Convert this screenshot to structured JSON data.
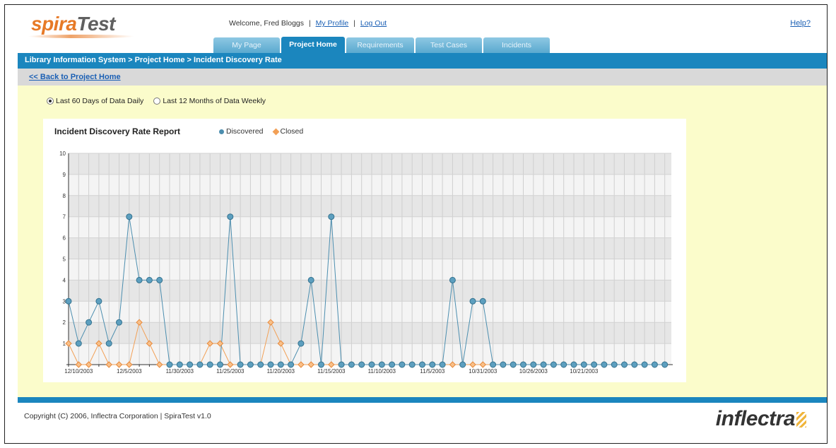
{
  "header": {
    "logo_part1": "spira",
    "logo_part2": "Test",
    "welcome_text": "Welcome, Fred Bloggs",
    "my_profile": "My Profile",
    "log_out": "Log Out",
    "help": "Help?"
  },
  "tabs": [
    {
      "label": "My Page",
      "active": false
    },
    {
      "label": "Project Home",
      "active": true
    },
    {
      "label": "Requirements",
      "active": false
    },
    {
      "label": "Test Cases",
      "active": false
    },
    {
      "label": "Incidents",
      "active": false
    }
  ],
  "breadcrumb": "Library Information System > Project Home > Incident Discovery Rate",
  "back_link": "<< Back to Project Home",
  "options": {
    "daily": "Last 60 Days of Data Daily",
    "weekly": "Last 12 Months of Data Weekly",
    "selected": "daily"
  },
  "chart_title": "Incident Discovery Rate Report",
  "legend": {
    "discovered": "Discovered",
    "closed": "Closed"
  },
  "colors": {
    "discovered": "#4c8eaf",
    "closed": "#f2a056",
    "accent": "#1b86be",
    "content_bg": "#fbfccb"
  },
  "chart_data": {
    "type": "line",
    "title": "Incident Discovery Rate Report",
    "xlabel": "",
    "ylabel": "",
    "ylim": [
      0,
      10
    ],
    "yticks": [
      1,
      2,
      3,
      4,
      5,
      6,
      7,
      8,
      9,
      10
    ],
    "grid": true,
    "legend_position": "top",
    "x_tick_labels": [
      {
        "index": 1,
        "label": "12/10/2003"
      },
      {
        "index": 6,
        "label": "12/5/2003"
      },
      {
        "index": 11,
        "label": "11/30/2003"
      },
      {
        "index": 16,
        "label": "11/25/2003"
      },
      {
        "index": 21,
        "label": "11/20/2003"
      },
      {
        "index": 26,
        "label": "11/15/2003"
      },
      {
        "index": 31,
        "label": "11/10/2003"
      },
      {
        "index": 36,
        "label": "11/5/2003"
      },
      {
        "index": 41,
        "label": "10/31/2003"
      },
      {
        "index": 46,
        "label": "10/26/2003"
      },
      {
        "index": 51,
        "label": "10/21/2003"
      }
    ],
    "series": [
      {
        "name": "Discovered",
        "values": [
          3,
          1,
          2,
          3,
          1,
          2,
          7,
          4,
          4,
          4,
          0,
          0,
          0,
          0,
          0,
          0,
          7,
          0,
          0,
          0,
          0,
          0,
          0,
          1,
          4,
          0,
          7,
          0,
          0,
          0,
          0,
          0,
          0,
          0,
          0,
          0,
          0,
          0,
          4,
          0,
          3,
          3,
          0,
          0,
          0,
          0,
          0,
          0,
          0,
          0,
          0,
          0,
          0,
          0,
          0,
          0,
          0,
          0,
          0,
          0
        ]
      },
      {
        "name": "Closed",
        "values": [
          1,
          0,
          0,
          1,
          0,
          0,
          0,
          2,
          1,
          0,
          0,
          0,
          0,
          0,
          1,
          1,
          0,
          0,
          0,
          0,
          2,
          1,
          0,
          0,
          0,
          0,
          0,
          0,
          0,
          0,
          0,
          0,
          0,
          0,
          0,
          0,
          0,
          0,
          0,
          0,
          0,
          0,
          0,
          0,
          0,
          0,
          0,
          0,
          0,
          0,
          0,
          0,
          0,
          0,
          0,
          0,
          0,
          0,
          0,
          0
        ]
      }
    ]
  },
  "footer": {
    "copyright": "Copyright (C) 2006, Inflectra Corporation | SpiraTest v1.0",
    "brand": "inflectra"
  }
}
